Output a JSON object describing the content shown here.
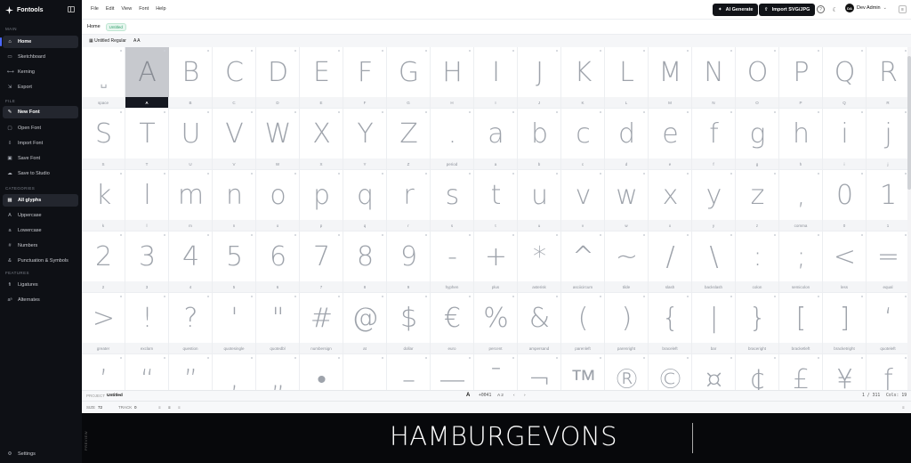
{
  "app": {
    "name": "Fontools"
  },
  "sidebar": {
    "main_label": "MAIN",
    "main_items": [
      {
        "label": "Home",
        "icon": "home-icon",
        "glyph": "⌂"
      },
      {
        "label": "Sketchboard",
        "icon": "sketch-icon",
        "glyph": "▭"
      },
      {
        "label": "Kerning",
        "icon": "kerning-icon",
        "glyph": "⟷"
      },
      {
        "label": "Export",
        "icon": "export-icon",
        "glyph": "⇲"
      }
    ],
    "file_label": "FILE",
    "file_items": [
      {
        "label": "New Font",
        "icon": "new-font-icon",
        "glyph": "✎"
      },
      {
        "label": "Open Font",
        "icon": "folder-icon",
        "glyph": "▢"
      },
      {
        "label": "Import Font",
        "icon": "import-icon",
        "glyph": "⇩"
      },
      {
        "label": "Save Font",
        "icon": "save-icon",
        "glyph": "▣"
      },
      {
        "label": "Save to Studio",
        "icon": "cloud-icon",
        "glyph": "☁"
      }
    ],
    "categories_label": "CATEGORIES",
    "category_items": [
      {
        "label": "All glyphs",
        "icon": "grid-icon",
        "glyph": "▦"
      },
      {
        "label": "Uppercase",
        "icon": "uppercase-icon",
        "glyph": "A"
      },
      {
        "label": "Lowercase",
        "icon": "lowercase-icon",
        "glyph": "a"
      },
      {
        "label": "Numbers",
        "icon": "numbers-icon",
        "glyph": "#"
      },
      {
        "label": "Punctuation & Symbols",
        "icon": "punctuation-icon",
        "glyph": "&"
      }
    ],
    "features_label": "FEATURES",
    "feature_items": [
      {
        "label": "Ligatures",
        "icon": "ligature-icon",
        "glyph": "ﬁ"
      },
      {
        "label": "Alternates",
        "icon": "alternates-icon",
        "glyph": "aᵃ"
      }
    ],
    "settings": {
      "label": "Settings",
      "icon": "gear-icon",
      "glyph": "⚙"
    }
  },
  "topbar": {
    "menu": [
      "File",
      "Edit",
      "View",
      "Font",
      "Help"
    ],
    "ai_button": "AI Generate",
    "import_button": "Import SVG/JPG",
    "user_initials": "DA",
    "user_name": "Dev Admin"
  },
  "breadcrumb": {
    "home": "Home",
    "badge": "Untitled"
  },
  "tabstrip": {
    "font_tab": "Untitled Regular",
    "size_label": "A A"
  },
  "glyphs": [
    {
      "g": "␣",
      "n": "space"
    },
    {
      "g": "A",
      "n": "A"
    },
    {
      "g": "B",
      "n": "B"
    },
    {
      "g": "C",
      "n": "C"
    },
    {
      "g": "D",
      "n": "D"
    },
    {
      "g": "E",
      "n": "E"
    },
    {
      "g": "F",
      "n": "F"
    },
    {
      "g": "G",
      "n": "G"
    },
    {
      "g": "H",
      "n": "H"
    },
    {
      "g": "I",
      "n": "I"
    },
    {
      "g": "J",
      "n": "J"
    },
    {
      "g": "K",
      "n": "K"
    },
    {
      "g": "L",
      "n": "L"
    },
    {
      "g": "M",
      "n": "M"
    },
    {
      "g": "N",
      "n": "N"
    },
    {
      "g": "O",
      "n": "O"
    },
    {
      "g": "P",
      "n": "P"
    },
    {
      "g": "Q",
      "n": "Q"
    },
    {
      "g": "R",
      "n": "R"
    },
    {
      "g": "S",
      "n": "S"
    },
    {
      "g": "T",
      "n": "T"
    },
    {
      "g": "U",
      "n": "U"
    },
    {
      "g": "V",
      "n": "V"
    },
    {
      "g": "W",
      "n": "W"
    },
    {
      "g": "X",
      "n": "X"
    },
    {
      "g": "Y",
      "n": "Y"
    },
    {
      "g": "Z",
      "n": "Z"
    },
    {
      "g": ".",
      "n": "period"
    },
    {
      "g": "a",
      "n": "a"
    },
    {
      "g": "b",
      "n": "b"
    },
    {
      "g": "c",
      "n": "c"
    },
    {
      "g": "d",
      "n": "d"
    },
    {
      "g": "e",
      "n": "e"
    },
    {
      "g": "f",
      "n": "f"
    },
    {
      "g": "g",
      "n": "g"
    },
    {
      "g": "h",
      "n": "h"
    },
    {
      "g": "i",
      "n": "i"
    },
    {
      "g": "j",
      "n": "j"
    },
    {
      "g": "k",
      "n": "k"
    },
    {
      "g": "l",
      "n": "l"
    },
    {
      "g": "m",
      "n": "m"
    },
    {
      "g": "n",
      "n": "n"
    },
    {
      "g": "o",
      "n": "o"
    },
    {
      "g": "p",
      "n": "p"
    },
    {
      "g": "q",
      "n": "q"
    },
    {
      "g": "r",
      "n": "r"
    },
    {
      "g": "s",
      "n": "s"
    },
    {
      "g": "t",
      "n": "t"
    },
    {
      "g": "u",
      "n": "u"
    },
    {
      "g": "v",
      "n": "v"
    },
    {
      "g": "w",
      "n": "w"
    },
    {
      "g": "x",
      "n": "x"
    },
    {
      "g": "y",
      "n": "y"
    },
    {
      "g": "z",
      "n": "z"
    },
    {
      "g": ",",
      "n": "comma"
    },
    {
      "g": "0",
      "n": "0"
    },
    {
      "g": "1",
      "n": "1"
    },
    {
      "g": "2",
      "n": "2"
    },
    {
      "g": "3",
      "n": "3"
    },
    {
      "g": "4",
      "n": "4"
    },
    {
      "g": "5",
      "n": "5"
    },
    {
      "g": "6",
      "n": "6"
    },
    {
      "g": "7",
      "n": "7"
    },
    {
      "g": "8",
      "n": "8"
    },
    {
      "g": "9",
      "n": "9"
    },
    {
      "g": "-",
      "n": "hyphen"
    },
    {
      "g": "+",
      "n": "plus"
    },
    {
      "g": "*",
      "n": "asterisk"
    },
    {
      "g": "^",
      "n": "asciicircum"
    },
    {
      "g": "~",
      "n": "tilde"
    },
    {
      "g": "/",
      "n": "slash"
    },
    {
      "g": "\\",
      "n": "backslash"
    },
    {
      "g": ":",
      "n": "colon"
    },
    {
      "g": ";",
      "n": "semicolon"
    },
    {
      "g": "<",
      "n": "less"
    },
    {
      "g": "=",
      "n": "equal"
    },
    {
      "g": ">",
      "n": "greater"
    },
    {
      "g": "!",
      "n": "exclam"
    },
    {
      "g": "?",
      "n": "question"
    },
    {
      "g": "'",
      "n": "quotesingle"
    },
    {
      "g": "\"",
      "n": "quotedbl"
    },
    {
      "g": "#",
      "n": "numbersign"
    },
    {
      "g": "@",
      "n": "at"
    },
    {
      "g": "$",
      "n": "dollar"
    },
    {
      "g": "€",
      "n": "euro"
    },
    {
      "g": "%",
      "n": "percent"
    },
    {
      "g": "&",
      "n": "ampersand"
    },
    {
      "g": "(",
      "n": "parenleft"
    },
    {
      "g": ")",
      "n": "parenright"
    },
    {
      "g": "{",
      "n": "braceleft"
    },
    {
      "g": "|",
      "n": "bar"
    },
    {
      "g": "}",
      "n": "braceright"
    },
    {
      "g": "[",
      "n": "bracketleft"
    },
    {
      "g": "]",
      "n": "bracketright"
    },
    {
      "g": "‘",
      "n": "quoteleft"
    },
    {
      "g": "’",
      "n": ""
    },
    {
      "g": "“",
      "n": ""
    },
    {
      "g": "”",
      "n": ""
    },
    {
      "g": "‚",
      "n": ""
    },
    {
      "g": "„",
      "n": ""
    },
    {
      "g": "•",
      "n": ""
    },
    {
      "g": "_",
      "n": ""
    },
    {
      "g": "–",
      "n": ""
    },
    {
      "g": "—",
      "n": ""
    },
    {
      "g": "¯",
      "n": ""
    },
    {
      "g": "¬",
      "n": ""
    },
    {
      "g": "™",
      "n": ""
    },
    {
      "g": "®",
      "n": ""
    },
    {
      "g": "©",
      "n": ""
    },
    {
      "g": "¤",
      "n": ""
    },
    {
      "g": "¢",
      "n": ""
    },
    {
      "g": "£",
      "n": ""
    },
    {
      "g": "¥",
      "n": ""
    },
    {
      "g": "ƒ",
      "n": ""
    }
  ],
  "selected_glyph": "A",
  "status": {
    "project_label": "PROJECT",
    "project_name": "Untitled",
    "glyph_char": "A",
    "unicode": "+0041",
    "unicode_rest": "A 2",
    "count": "1 / 311",
    "cols": "Cols: 19"
  },
  "toolbar2": {
    "size_label": "SIZE",
    "size_value": "72",
    "track_label": "TRACK",
    "track_value": "0"
  },
  "preview": {
    "label": "PREVIEW",
    "text": "HAMBURGEVONS"
  }
}
